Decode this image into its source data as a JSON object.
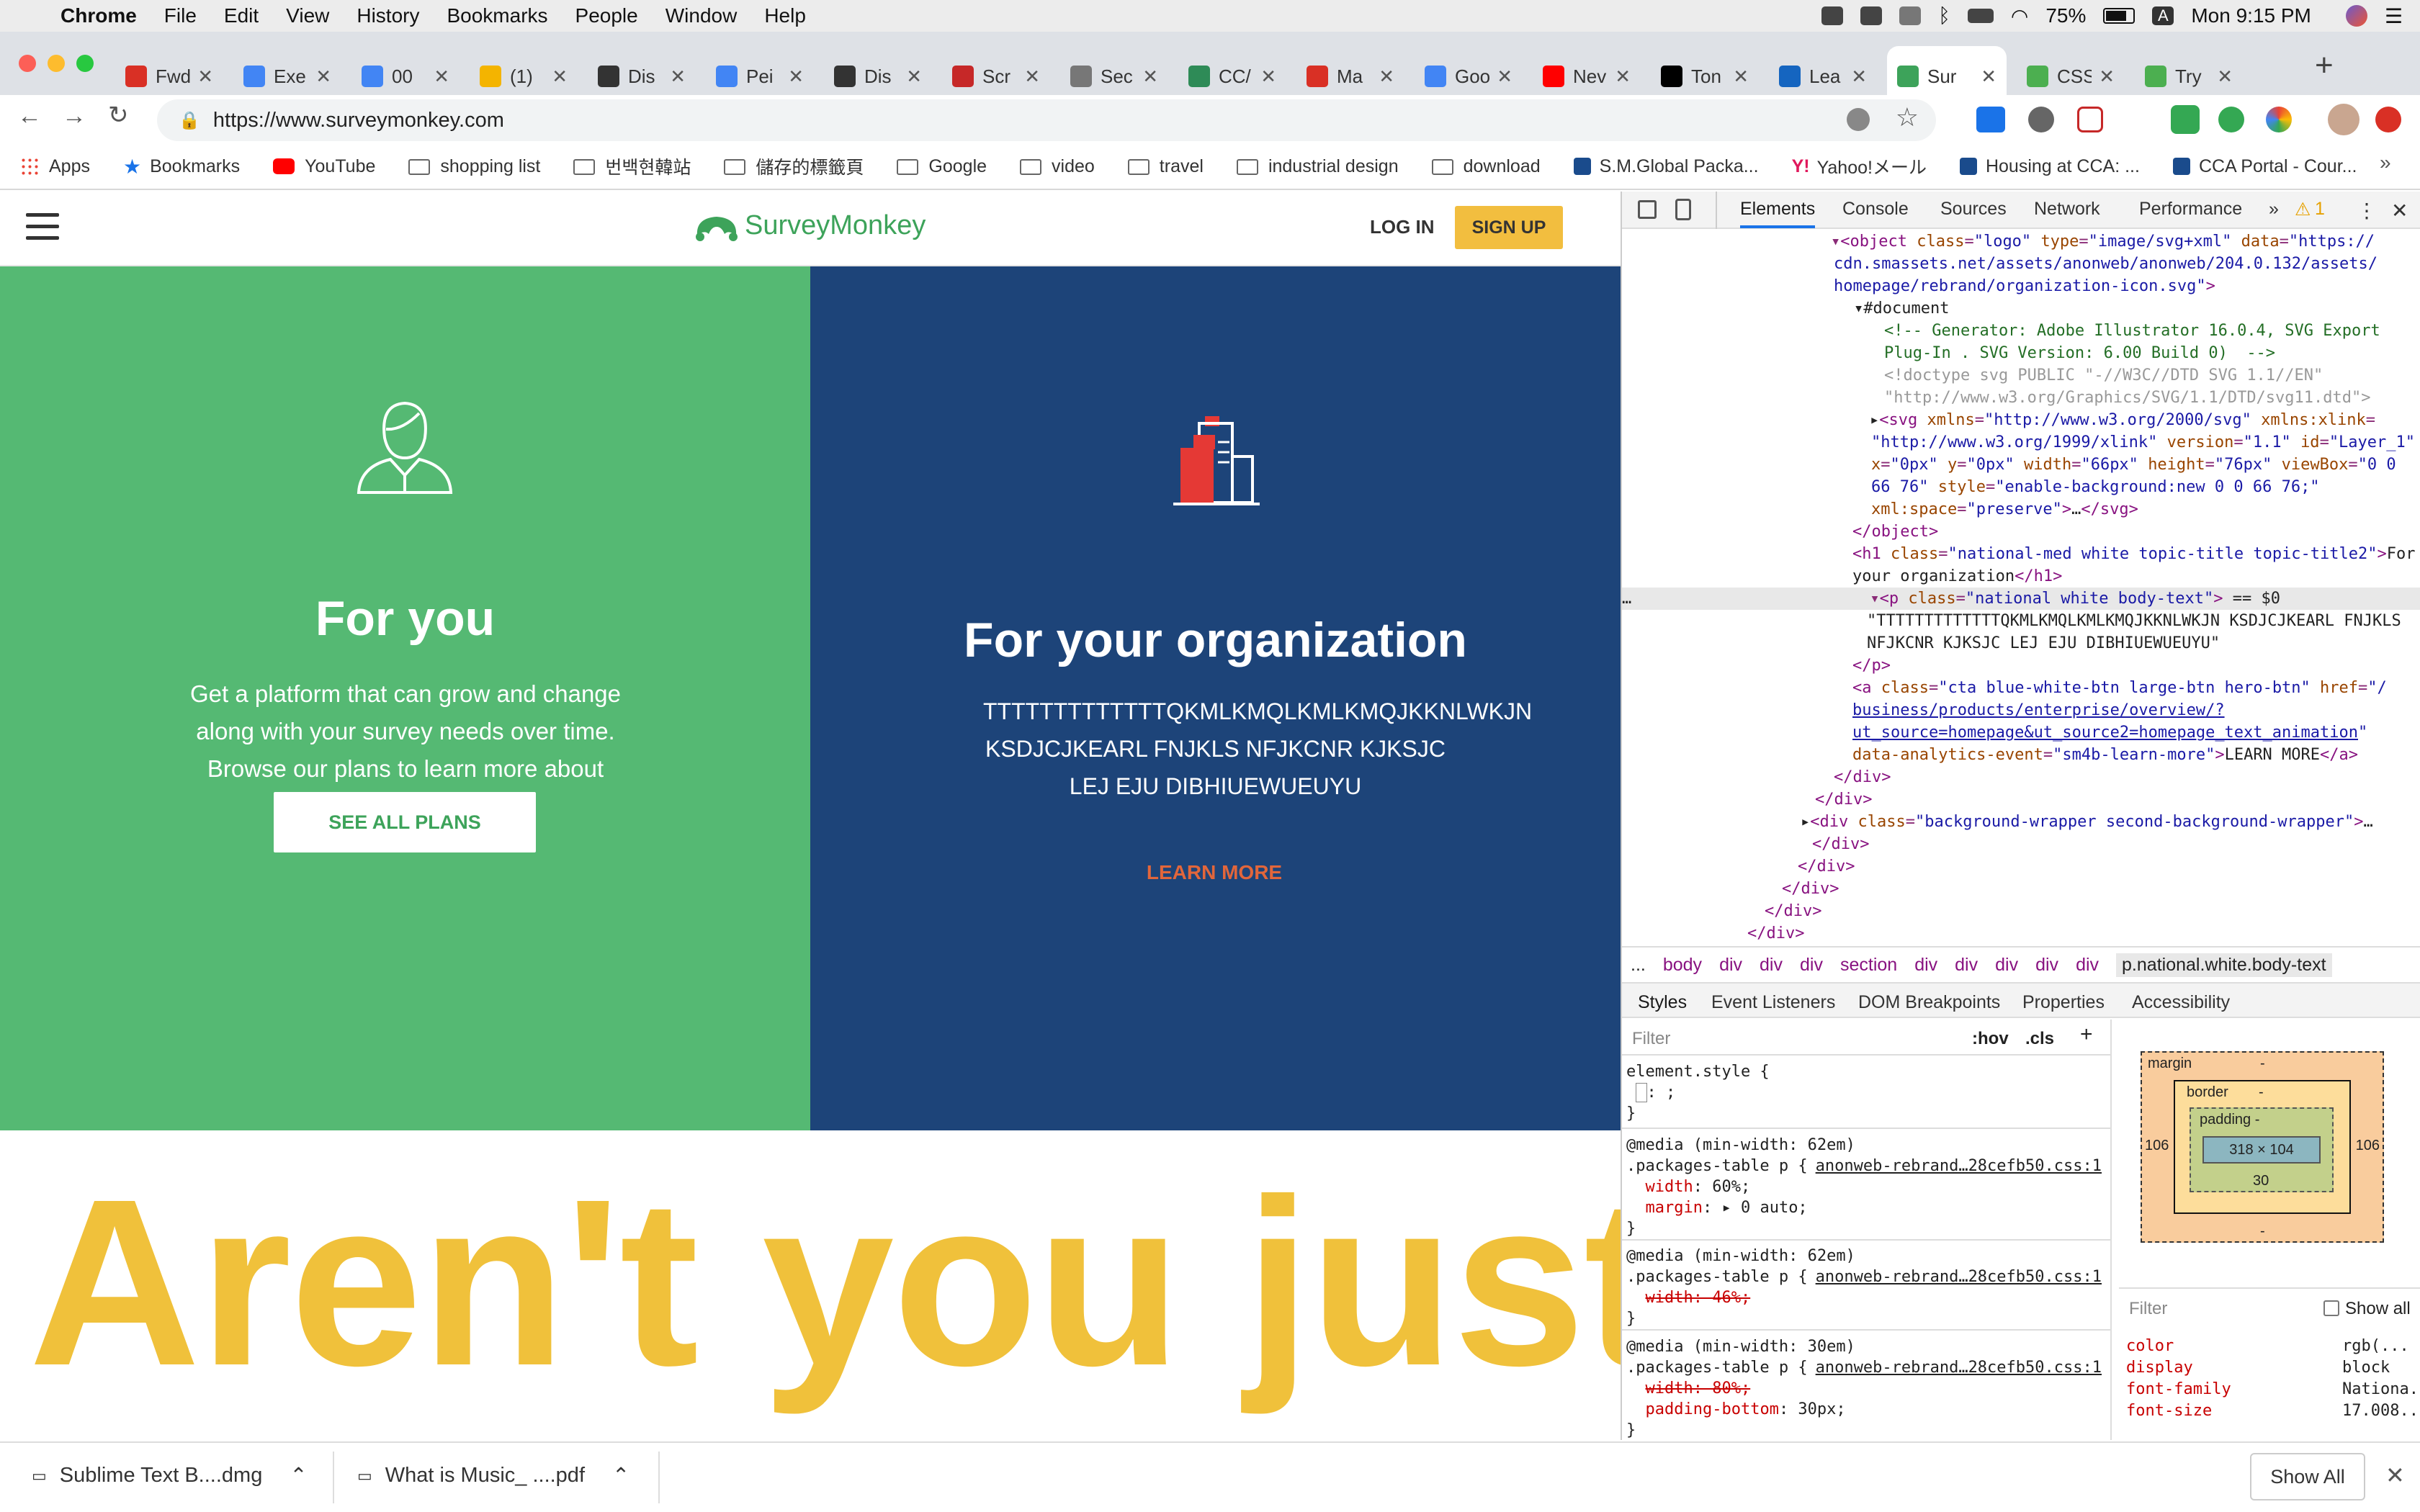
{
  "menubar": {
    "items": [
      "Chrome",
      "File",
      "Edit",
      "View",
      "History",
      "Bookmarks",
      "People",
      "Window",
      "Help"
    ],
    "battery": "75%",
    "clock": "Mon 9:15 PM"
  },
  "tabs": [
    {
      "title": "Fwd",
      "icon": "gmail-icon",
      "color": "#d93025"
    },
    {
      "title": "Exe",
      "icon": "docs-icon",
      "color": "#4285f4"
    },
    {
      "title": "00",
      "icon": "docs-icon",
      "color": "#4285f4"
    },
    {
      "title": "(1)",
      "icon": "yellow-tab-icon",
      "color": "#f4b400"
    },
    {
      "title": "Dis",
      "icon": "discord-icon",
      "color": "#333"
    },
    {
      "title": "Pei",
      "icon": "docs-icon",
      "color": "#4285f4"
    },
    {
      "title": "Dis",
      "icon": "discord-icon",
      "color": "#333"
    },
    {
      "title": "Scr",
      "icon": "red-square-icon",
      "color": "#c62828"
    },
    {
      "title": "Sec",
      "icon": "image-icon",
      "color": "#777"
    },
    {
      "title": "CC/",
      "icon": "cca-icon",
      "color": "#2e8b57"
    },
    {
      "title": "Ma",
      "icon": "gmail-icon",
      "color": "#d93025"
    },
    {
      "title": "Goo",
      "icon": "translate-icon",
      "color": "#4285f4"
    },
    {
      "title": "Nev",
      "icon": "youtube-icon",
      "color": "#ff0000"
    },
    {
      "title": "Ton",
      "icon": "fc-icon",
      "color": "#000"
    },
    {
      "title": "Lea",
      "icon": "learn-icon",
      "color": "#1565c0"
    },
    {
      "title": "Sur",
      "icon": "surveymonkey-icon",
      "color": "#3da35a",
      "active": true
    },
    {
      "title": "CSS",
      "icon": "w3-icon",
      "color": "#4caf50"
    },
    {
      "title": "Try",
      "icon": "w3-icon",
      "color": "#4caf50"
    }
  ],
  "url": "https://www.surveymonkey.com",
  "bookmarks": [
    {
      "label": "Apps",
      "kind": "apps"
    },
    {
      "label": "Bookmarks",
      "kind": "star"
    },
    {
      "label": "YouTube",
      "kind": "youtube"
    },
    {
      "label": "shopping list",
      "kind": "folder"
    },
    {
      "label": "번백현韓站",
      "kind": "folder"
    },
    {
      "label": "儲存的標籤頁",
      "kind": "folder"
    },
    {
      "label": "Google",
      "kind": "folder"
    },
    {
      "label": "video",
      "kind": "folder"
    },
    {
      "label": "travel",
      "kind": "folder"
    },
    {
      "label": "industrial design",
      "kind": "folder"
    },
    {
      "label": "download",
      "kind": "folder"
    },
    {
      "label": "S.M.Global Packa...",
      "kind": "link"
    },
    {
      "label": "Yahoo!メール",
      "kind": "yahoo"
    },
    {
      "label": "Housing at CCA: ...",
      "kind": "link"
    },
    {
      "label": "CCA Portal - Cour...",
      "kind": "link"
    }
  ],
  "site": {
    "brand": "SurveyMonkey",
    "login": "LOG IN",
    "signup": "SIGN UP",
    "left": {
      "title": "For you",
      "body": "Get a platform that can grow and change along with your survey needs over time. Browse our plans to learn more about specific features.",
      "cta": "SEE ALL PLANS"
    },
    "right": {
      "title": "For your organization",
      "body": "TTTTTTTTTTTTTQKMLKMQLKMLKMQJKKNLWKJN KSDJCJKEARL FNJKLS NFJKCNR KJKSJC LEJ EJU DIBHIUEWUEUYU",
      "cta": "LEARN MORE"
    },
    "banner": "Aren't you just"
  },
  "devtools": {
    "tabs": [
      "Elements",
      "Console",
      "Sources",
      "Network",
      "Performance"
    ],
    "warnings": "1",
    "breadcrumb": [
      "...",
      "body",
      "div",
      "div",
      "div",
      "section",
      "div",
      "div",
      "div",
      "div",
      "div",
      "p.national.white.body-text"
    ],
    "style_tabs": [
      "Styles",
      "Event Listeners",
      "DOM Breakpoints",
      "Properties",
      "Accessibility"
    ],
    "filter_placeholder": "Filter",
    "hov": ":hov",
    "cls": ".cls",
    "boxmodel": {
      "margin": "margin",
      "border": "border",
      "padding": "padding -",
      "content": "318 × 104",
      "side": "106",
      "bottom_pad": "30",
      "dash": "-"
    },
    "computed_filter": "Filter",
    "show_all": "Show all",
    "computed": [
      {
        "p": "color",
        "v": "rgb(..."
      },
      {
        "p": "display",
        "v": "block"
      },
      {
        "p": "font-family",
        "v": "Nationa..."
      },
      {
        "p": "font-size",
        "v": "17.008..."
      }
    ]
  },
  "downloads": [
    {
      "name": "Sublime Text B....dmg"
    },
    {
      "name": "What is Music_ ....pdf"
    }
  ],
  "downloads_show_all": "Show All"
}
